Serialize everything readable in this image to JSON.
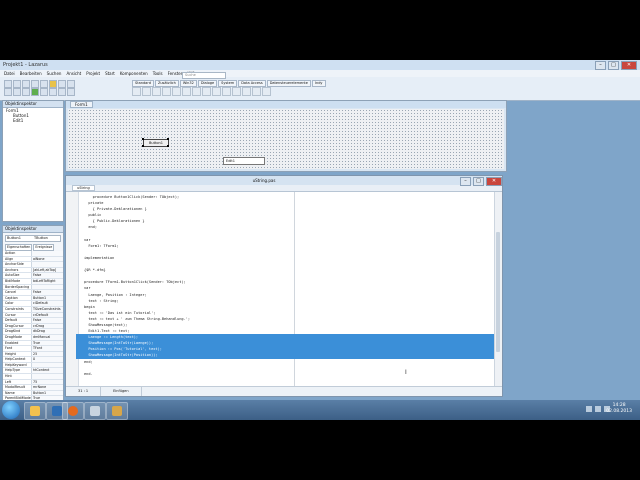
{
  "ide": {
    "title": "Projekt1 - Lazarus",
    "search_placeholder": "Suche",
    "menu": [
      "Datei",
      "Bearbeiten",
      "Suchen",
      "Ansicht",
      "Projekt",
      "Start",
      "Komponenten",
      "Tools",
      "Fenster",
      "Hilfe"
    ],
    "palette_tabs": [
      "Standard",
      "Zusätzlich",
      "Win32",
      "Dialoge",
      "System",
      "Data Access",
      "Datensteuerelemente",
      "Indy"
    ]
  },
  "object_tree": {
    "title": "Objektinspektor",
    "items": [
      "Form1",
      "Button1",
      "Edit1"
    ]
  },
  "inspector": {
    "title": "Objektinspektor",
    "selected": "Button1",
    "selected_type": "TButton",
    "tabs": [
      "Eigenschaften",
      "Ereignisse"
    ],
    "properties": [
      [
        "Action",
        ""
      ],
      [
        "Align",
        "alNone"
      ],
      [
        "AnchorSide",
        ""
      ],
      [
        "Anchors",
        "[akLeft,akTop]"
      ],
      [
        "AutoSize",
        "False"
      ],
      [
        "BidiMode",
        "bdLeftToRight"
      ],
      [
        "BorderSpacing",
        ""
      ],
      [
        "Cancel",
        "False"
      ],
      [
        "Caption",
        "Button1"
      ],
      [
        "Color",
        "clDefault"
      ],
      [
        "Constraints",
        "TSizeConstraints"
      ],
      [
        "Cursor",
        "crDefault"
      ],
      [
        "Default",
        "False"
      ],
      [
        "DragCursor",
        "crDrag"
      ],
      [
        "DragKind",
        "dkDrag"
      ],
      [
        "DragMode",
        "dmManual"
      ],
      [
        "Enabled",
        "True"
      ],
      [
        "Font",
        "TFont"
      ],
      [
        "Height",
        "25"
      ],
      [
        "HelpContext",
        "0"
      ],
      [
        "HelpKeyword",
        ""
      ],
      [
        "HelpType",
        "htContext"
      ],
      [
        "Hint",
        ""
      ],
      [
        "Left",
        "75"
      ],
      [
        "ModalResult",
        "mrNone"
      ],
      [
        "Name",
        "Button1"
      ],
      [
        "ParentBidiMode",
        "True"
      ],
      [
        "ParentFont",
        "True"
      ],
      [
        "ParentShowHint",
        "True"
      ],
      [
        "PopupMenu",
        ""
      ],
      [
        "ShowHint",
        "False"
      ],
      [
        "TabOrder",
        "0"
      ],
      [
        "TabStop",
        "True"
      ],
      [
        "Tag",
        "0"
      ]
    ],
    "footer": "Alle anzeigen"
  },
  "form": {
    "tab": "Form1",
    "button_caption": "Button1",
    "edit_text": "Edit1"
  },
  "editor": {
    "title": "uString.pas",
    "tab": "uString",
    "lines": [
      "    procedure Button1Click(Sender: TObject);",
      "  private",
      "    { Private-Deklarationen }",
      "  public",
      "    { Public-Deklarationen }",
      "  end;",
      "",
      "var",
      "  Form1: TForm1;",
      "",
      "implementation",
      "",
      "{$R *.dfm}",
      "",
      "procedure TForm1.Button1Click(Sender: TObject);",
      "var",
      "  Laenge, Position : Integer;",
      "  text : String;",
      "begin",
      "  text := 'Das ist ein Tutorial';",
      "  text := text + ' zum Thema String-Behandlung.';",
      "  ShowMessage(text);",
      "  Edit1.Text := text;",
      "  Laenge := Length(text);",
      "  ShowMessage(IntToStr(Laenge));",
      "  Position := Pos('Tutorial', text);",
      "  ShowMessage(IntToStr(Position));",
      "end;",
      "",
      "end."
    ],
    "selected_from": 23,
    "selected_to": 26,
    "status": [
      "31 : 1",
      "Einfügen"
    ]
  },
  "taskbar": {
    "time": "14:28",
    "date": "02.08.2013"
  }
}
